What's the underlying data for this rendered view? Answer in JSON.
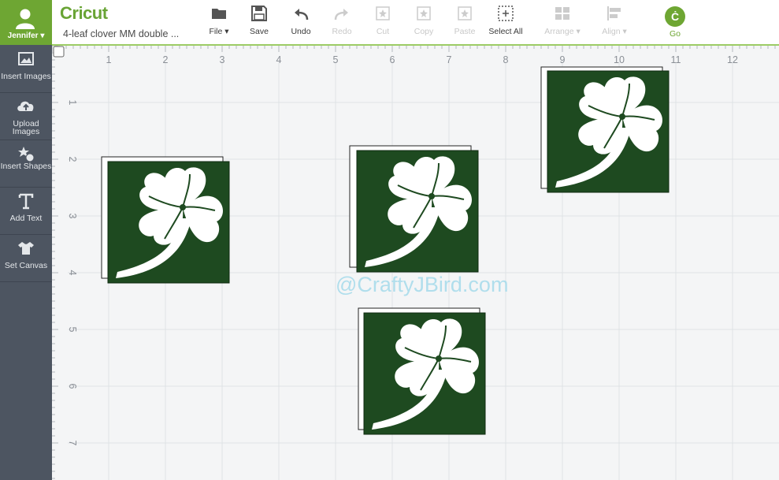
{
  "user": {
    "name": "Jennifer",
    "caret": "▾"
  },
  "sidebar": {
    "items": [
      {
        "label": "Insert Images",
        "icon": "image-icon"
      },
      {
        "label": "Upload Images",
        "icon": "cloud-upload-icon"
      },
      {
        "label": "Insert Shapes",
        "icon": "shapes-icon"
      },
      {
        "label": "Add Text",
        "icon": "text-icon"
      },
      {
        "label": "Set Canvas",
        "icon": "shirt-icon"
      }
    ]
  },
  "header": {
    "brand": "Cricut",
    "project_title": "4-leaf clover MM double ..."
  },
  "toolbar": {
    "file": "File",
    "save": "Save",
    "undo": "Undo",
    "redo": "Redo",
    "cut": "Cut",
    "copy": "Copy",
    "paste": "Paste",
    "select_all": "Select All",
    "arrange": "Arrange",
    "align": "Align",
    "go": "Go",
    "go_glyph": "Ċ"
  },
  "ruler": {
    "top": [
      "1",
      "2",
      "3",
      "4",
      "5",
      "6",
      "7",
      "8",
      "9",
      "10",
      "11",
      "12"
    ],
    "left": [
      "1",
      "2",
      "3",
      "4",
      "5",
      "6",
      "7"
    ]
  },
  "watermark": "@CraftyJBird.com",
  "colors": {
    "brand_green": "#6ea633",
    "clover_green": "#1e4a20",
    "sidebar": "#4d5561",
    "canvas_bg": "#f4f5f6"
  }
}
